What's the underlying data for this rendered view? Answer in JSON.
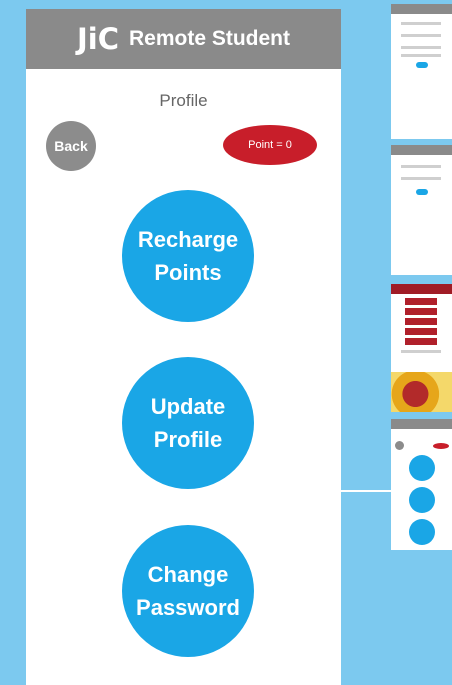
{
  "app": {
    "logo_text": "JiC",
    "title": "Remote Student"
  },
  "page": {
    "title": "Profile"
  },
  "header": {
    "back_label": "Back",
    "points_label": "Point = 0"
  },
  "actions": [
    {
      "line1": "Recharge",
      "line2": "Points"
    },
    {
      "line1": "Update",
      "line2": "Profile"
    },
    {
      "line1": "Change",
      "line2": "Password"
    }
  ],
  "colors": {
    "appbar": "#8a8a8a",
    "primary_button": "#1aa6e6",
    "points_badge": "#c81e2a",
    "back_button": "#8c8c8c",
    "background": "#7cc9ef"
  }
}
